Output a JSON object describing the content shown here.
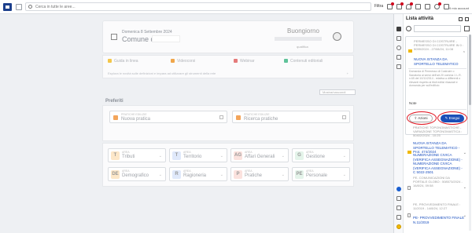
{
  "topbar": {
    "search_placeholder": "Cerca in tutte le aree...",
    "filter_label": "Filtra",
    "user_link": "Il mio account",
    "icons": [
      "cart-icon",
      "box-icon",
      "bell-icon",
      "grid-icon",
      "mail-icon",
      "pin-icon",
      "download-icon"
    ]
  },
  "welcome": {
    "date": "Domenica 8 Settembre 2024",
    "comune_label": "Comune di",
    "greeting": "Buongiorno",
    "role": "qualifica"
  },
  "quicklinks": {
    "items": [
      {
        "label": "Guida in linea",
        "color": "#f3c64a"
      },
      {
        "label": "Videocorsi",
        "color": "#f0a64b"
      },
      {
        "label": "Webinar",
        "color": "#e57b7b"
      },
      {
        "label": "Contenuti editoriali",
        "color": "#5fc39a"
      }
    ],
    "note": "Esplora le novità sulle definizioni e impara ad utilizzare gli strumenti della rete",
    "right_label": "+"
  },
  "mostra_label": "Mostra/nascondi",
  "preferiti": {
    "title": "Preferiti",
    "cards": [
      {
        "small": "PRATICHE EDILIZIE",
        "label": "Nuova pratica",
        "color": "#f3a55b"
      },
      {
        "small": "PRATICHE EDILIZIE",
        "label": "Ricerca pratiche",
        "color": "#f3a55b"
      }
    ]
  },
  "areas": [
    {
      "small": "AREA",
      "label": "Tributi",
      "letter": "T",
      "color": "#fde7c8"
    },
    {
      "small": "AREA",
      "label": "Territorio",
      "letter": "T",
      "color": "#e0e9fb"
    },
    {
      "small": "AREA",
      "label": "Affari Generali",
      "letter": "AG",
      "color": "#fbe2de"
    },
    {
      "small": "AREA",
      "label": "Gestione",
      "letter": "G",
      "color": "#e4f4ea"
    },
    {
      "small": "AREA",
      "label": "Demografico",
      "letter": "DE",
      "color": "#fde7c8"
    },
    {
      "small": "AREA",
      "label": "Ragioneria",
      "letter": "R",
      "color": "#e0e9fb"
    },
    {
      "small": "AREA",
      "label": "Pratiche",
      "letter": "P",
      "color": "#fbe2de"
    },
    {
      "small": "AREA",
      "label": "Personale",
      "letter": "PE",
      "color": "#e4f4ea"
    }
  ],
  "panel": {
    "title": "Lista attività",
    "card1": {
      "header": "PERMESSO DI COSTRUIRE - PERMESSO DI COSTRUIRE IN 0 : 5099/2024 - 27/08/24, 11:08",
      "link": "NUOVA ISTANZA DA SPORTELLO TELEMATICO",
      "body": "Domanda di Permesso di Costruire o Sanatoria ai sensi dell'art.20 comma 1 L.R. n.65 del 10/11/2014 - relativa a differenti o rilevanti rispetto ai titoli edilizi rilasciati e domanda per sull'edificio",
      "note_label": "Note",
      "azioni": "Azioni",
      "esegui": "Esegui"
    },
    "entry2": {
      "header": "PRATICHE TOPONOMASTICHE - VARIAZIONE TOPONOMASTICA : 50402/2024 - 10:25",
      "link": "NUOVA ISTANZA DA SPORTELLO TELEMATICO - Prot. 474/2024",
      "body": "NUMERAZIONE CIVICA (VERIFICA ASSEGNAZIONE) - NUMERAZIONE CIVICA (VERIFICA ASSEGNAZIONE) - C 5022-2501"
    },
    "entry3": {
      "header": "PE- COMUNICAZIONI DA PORTALE GLOBO : 508573/2024 - 16/8/24, 09:58"
    },
    "entry4": {
      "header": "PE- PROVVEDIMENTO FINALE : 11/2019 - 14/8/24, 12:27",
      "link": "PE- PROVVEDIMENTO FINALE N.11/2019"
    }
  }
}
